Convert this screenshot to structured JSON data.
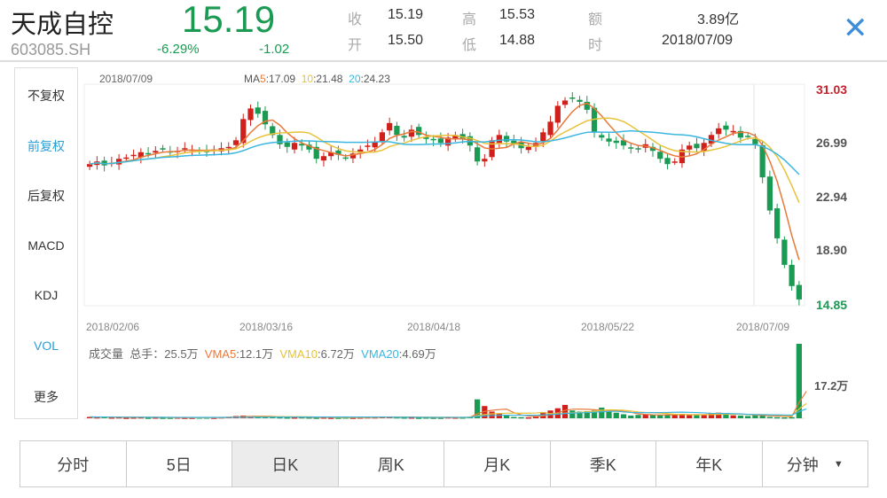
{
  "header": {
    "name": "天成自控",
    "code": "603085.SH",
    "price": "15.19",
    "change_pct": "-6.29%",
    "change": "-1.02",
    "stats": [
      {
        "label": "收",
        "value": "15.19"
      },
      {
        "label": "高",
        "value": "15.53"
      },
      {
        "label": "额",
        "value": "3.89亿"
      },
      {
        "label": "开",
        "value": "15.50"
      },
      {
        "label": "低",
        "value": "14.88"
      },
      {
        "label": "时",
        "value": "2018/07/09"
      }
    ],
    "close_icon": "close-icon"
  },
  "sidebar": {
    "items": [
      {
        "label": "不复权"
      },
      {
        "label": "前复权",
        "active": true
      },
      {
        "label": "后复权"
      },
      {
        "label": "MACD"
      },
      {
        "label": "KDJ"
      },
      {
        "label": "VOL",
        "active": true
      },
      {
        "label": "更多"
      }
    ]
  },
  "chart": {
    "date": "2018/07/09",
    "ma_prefix": "MA",
    "ma5_num": "5",
    "ma5_val": ":17.09",
    "ma10_num": "10",
    "ma10_val": ":21.48",
    "ma20_num": "20",
    "ma20_val": ":24.23",
    "y_labels": [
      "31.03",
      "26.99",
      "22.94",
      "18.90",
      "14.85"
    ],
    "x_labels": [
      "2018/02/06",
      "2018/03/16",
      "2018/04/18",
      "2018/05/22",
      "2018/07/09"
    ],
    "vol_title": "成交量",
    "vol_total": "总手：25.5万",
    "vma5_num": "VMA5",
    "vma5_val": ":12.1万",
    "vma10_num": "VMA10",
    "vma10_val": ":6.72万",
    "vma20_num": "VMA20",
    "vma20_val": ":4.69万",
    "vol_axis": "17.2万",
    "colors": {
      "up": "#d0201b",
      "down": "#1a9a52",
      "ma5": "#e8793a",
      "ma10": "#e8c23a",
      "ma20": "#3ab6e0"
    }
  },
  "chart_data": {
    "type": "candlestick",
    "ylim": [
      14.85,
      31.03
    ],
    "closes": [
      25.4,
      25.6,
      25.3,
      25.5,
      25.8,
      25.9,
      26.1,
      26.3,
      26.2,
      26.4,
      26.5,
      26.3,
      26.4,
      26.6,
      26.5,
      26.4,
      26.3,
      26.5,
      26.6,
      26.7,
      27.2,
      28.8,
      29.6,
      29.2,
      28.4,
      27.6,
      26.9,
      26.7,
      27.0,
      26.8,
      26.5,
      25.8,
      26.0,
      26.3,
      26.1,
      25.9,
      26.2,
      26.5,
      26.8,
      27.1,
      27.8,
      28.5,
      27.6,
      27.4,
      28.0,
      27.6,
      27.3,
      27.2,
      27.0,
      27.4,
      27.6,
      27.3,
      26.8,
      25.6,
      25.8,
      27.2,
      27.6,
      27.1,
      26.9,
      26.6,
      26.7,
      27.0,
      27.8,
      28.6,
      29.8,
      30.2,
      30.4,
      30.1,
      29.5,
      27.8,
      27.4,
      27.1,
      27.0,
      26.8,
      26.6,
      26.5,
      26.9,
      26.4,
      25.8,
      25.4,
      25.6,
      26.5,
      26.8,
      26.6,
      27.0,
      27.6,
      28.1,
      28.0,
      27.9,
      27.4,
      27.5,
      26.9,
      24.4,
      21.9,
      19.8,
      17.8,
      16.2,
      15.19
    ],
    "volumes": [
      0.6,
      0.5,
      0.6,
      0.4,
      0.5,
      0.3,
      0.4,
      0.5,
      0.3,
      0.4,
      0.3,
      0.3,
      0.4,
      0.3,
      0.3,
      0.4,
      0.4,
      0.3,
      0.5,
      0.6,
      1.0,
      1.2,
      0.9,
      0.8,
      0.7,
      0.6,
      0.5,
      0.4,
      0.4,
      0.5,
      0.4,
      0.3,
      0.4,
      0.3,
      0.3,
      0.4,
      0.3,
      0.4,
      0.5,
      0.5,
      0.8,
      0.6,
      0.5,
      0.4,
      0.4,
      0.3,
      0.4,
      0.3,
      0.3,
      0.5,
      0.4,
      0.4,
      0.6,
      8.5,
      5.5,
      3.0,
      2.0,
      1.5,
      0.6,
      0.5,
      0.4,
      1.0,
      2.8,
      3.5,
      4.5,
      6.0,
      3.5,
      3.0,
      3.2,
      3.5,
      4.8,
      3.0,
      2.5,
      1.8,
      1.2,
      1.5,
      1.7,
      1.6,
      1.4,
      1.5,
      1.8,
      2.0,
      1.4,
      1.5,
      1.4,
      2.2,
      2.5,
      2.4,
      1.3,
      1.2,
      1.0,
      1.4,
      1.6,
      0.6,
      0.5,
      0.4,
      0.5,
      33.5,
      25.5
    ]
  }
}
